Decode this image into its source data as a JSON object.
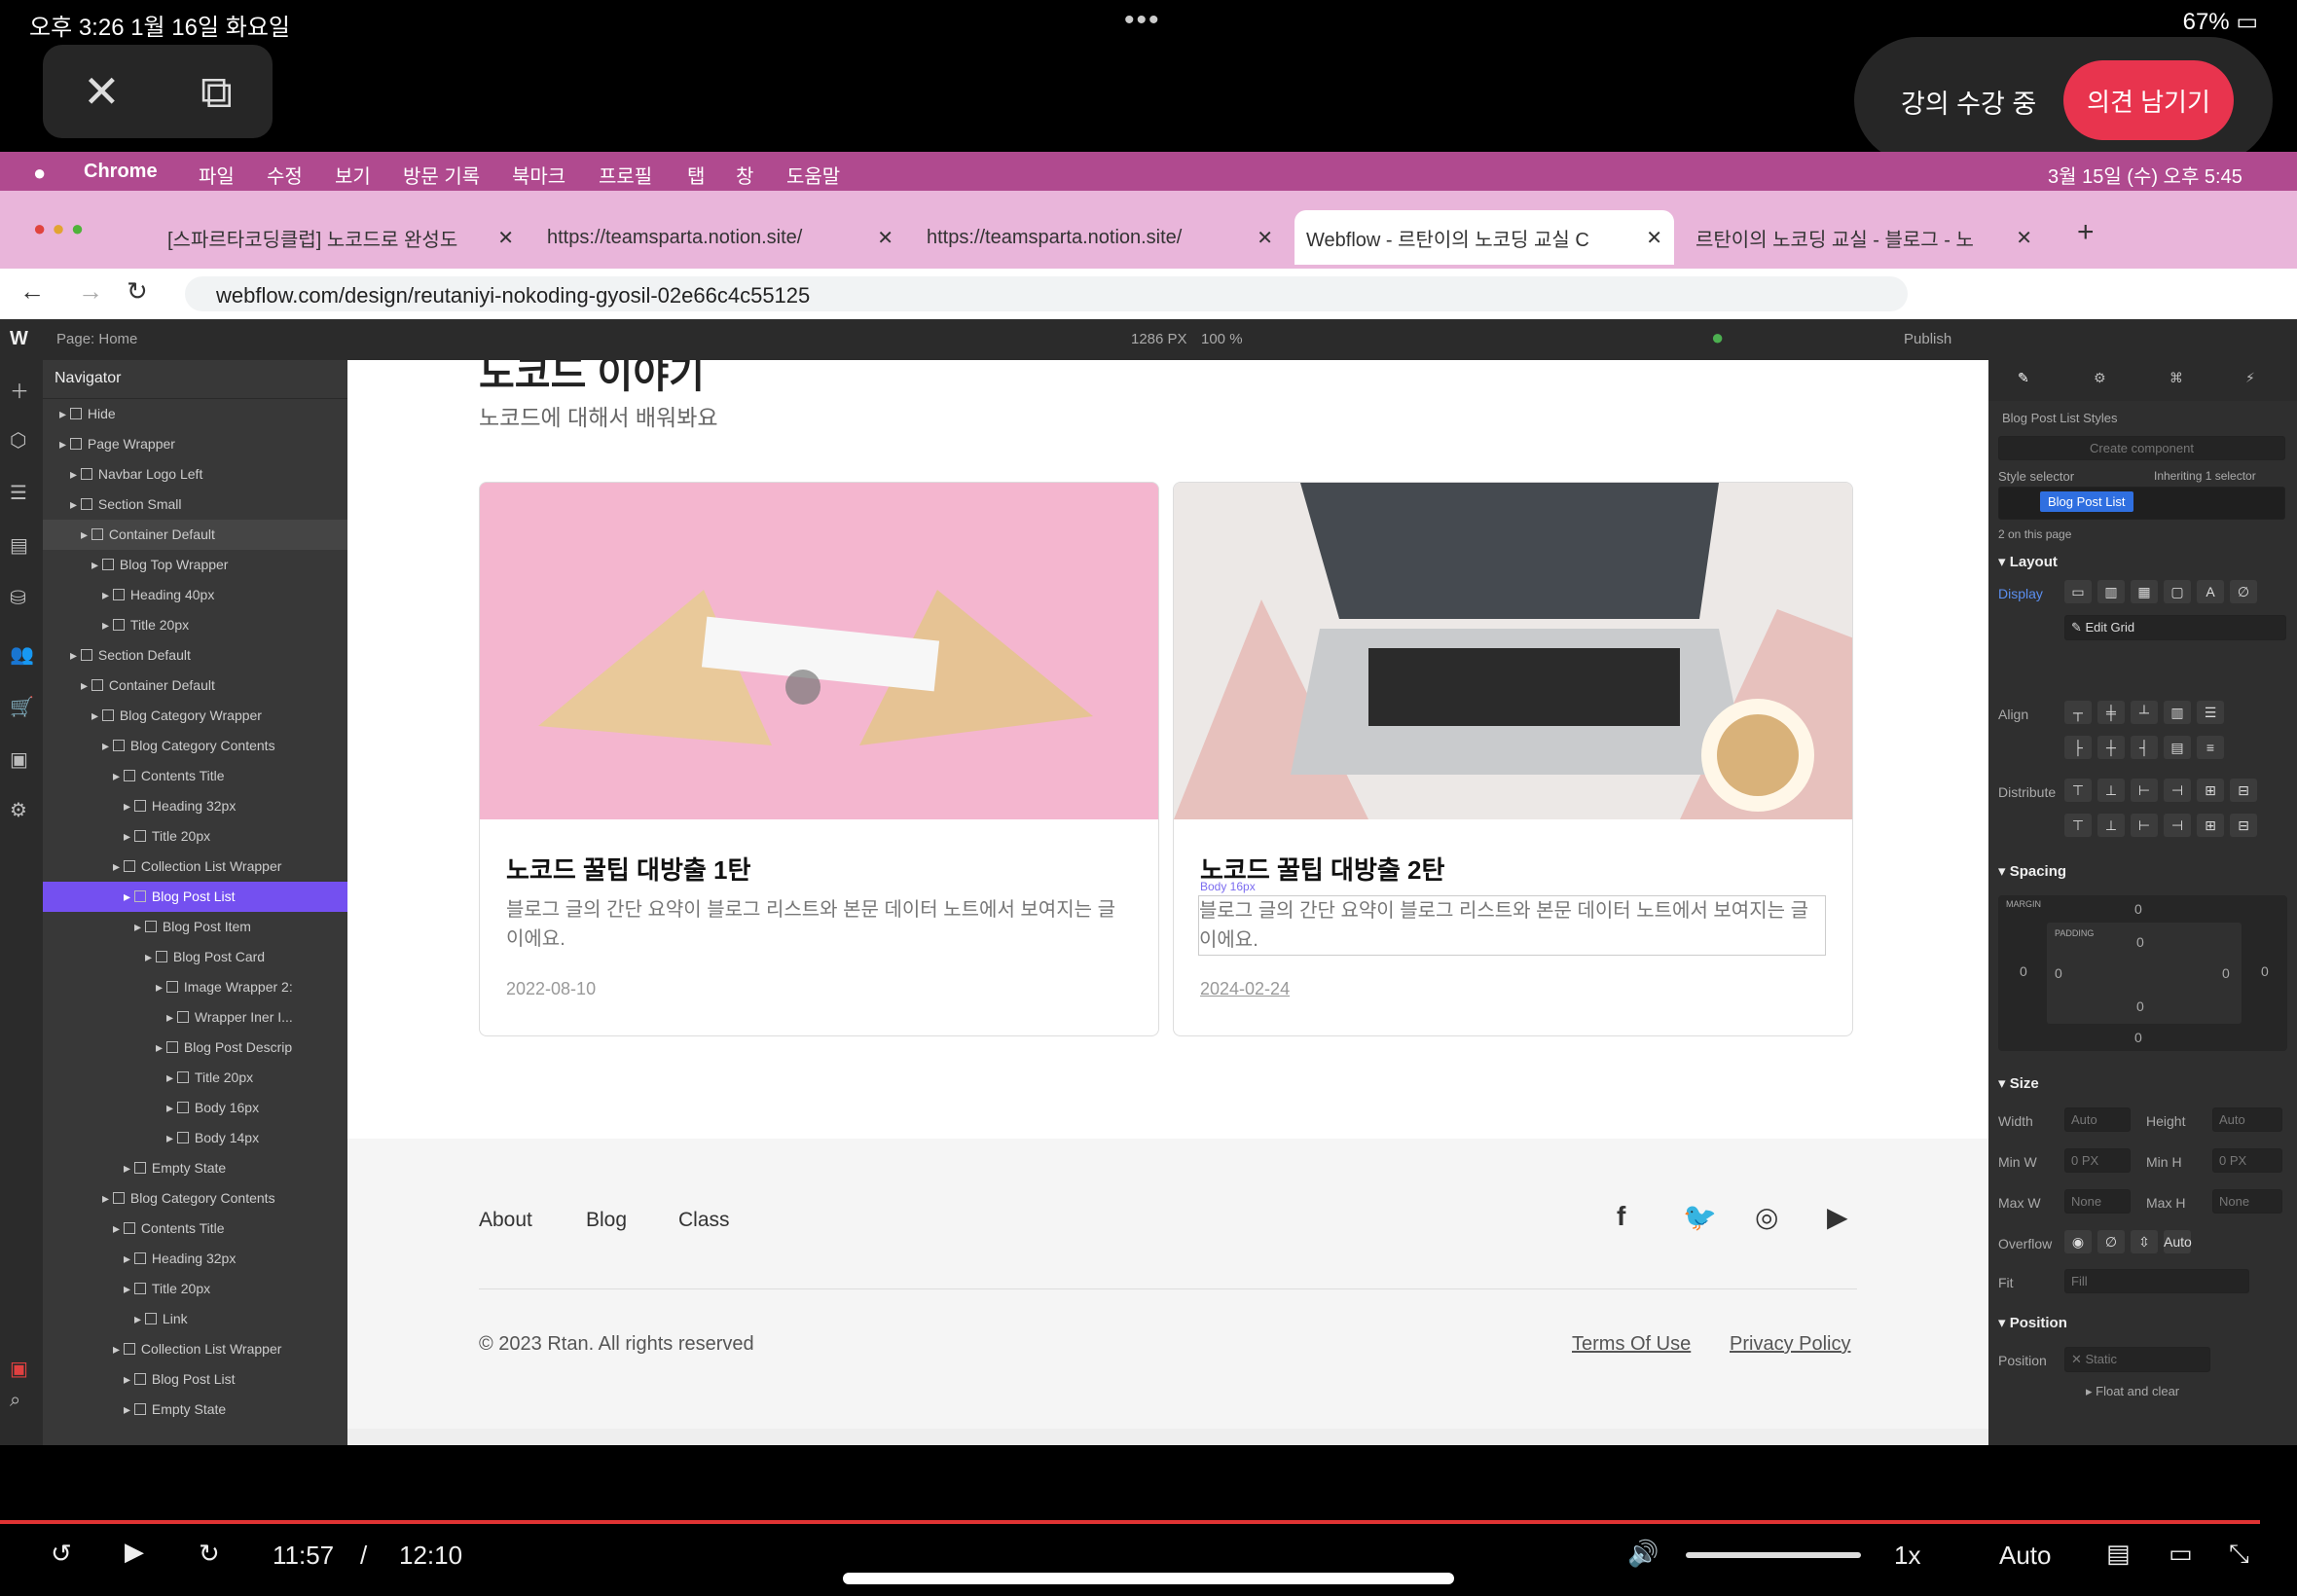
{
  "status": {
    "time": "오후 3:26  1월 16일 화요일",
    "dots": "•••",
    "battery": "67%"
  },
  "overlay": {
    "close": "✕",
    "pip": "⧉",
    "lecture_text": "강의 수강 중",
    "feedback_btn": "의견 남기기"
  },
  "mac_menu": {
    "items": [
      "",
      "Chrome",
      "파일",
      "수정",
      "보기",
      "방문 기록",
      "북마크",
      "프로필",
      "탭",
      "창",
      "도움말"
    ],
    "clock": "3월 15일 (수) 오후 5:45"
  },
  "tabs": [
    {
      "label": "[스파르타코딩클럽] 노코드로 완성도",
      "close": "✕"
    },
    {
      "label": "https://teamsparta.notion.site/",
      "close": "✕"
    },
    {
      "label": "https://teamsparta.notion.site/",
      "close": "✕"
    },
    {
      "label": "Webflow - 르탄이의 노코딩 교실 C",
      "close": "✕"
    },
    {
      "label": "르탄이의 노코딩 교실 - 블로그 - 노",
      "close": "✕"
    }
  ],
  "address": {
    "url": "webflow.com/design/reutaniyi-nokoding-gyosil-02e66c4c55125"
  },
  "webflow_top": {
    "page": "Page: Home",
    "width": "1286 PX",
    "zoom": "100 %",
    "publish": "Publish"
  },
  "navigator": {
    "title": "Navigator",
    "rows": [
      "Hide",
      "Page Wrapper",
      "Navbar Logo Left",
      "Section Small",
      "Container Default",
      "Blog Top Wrapper",
      "Heading 40px",
      "Title 20px",
      "Section Default",
      "Container Default",
      "Blog Category Wrapper",
      "Blog Category Contents",
      "Contents Title",
      "Heading 32px",
      "Title 20px",
      "Collection List Wrapper",
      "Blog Post List",
      "Blog Post Item",
      "Blog Post Card",
      "Image Wrapper 2:",
      "Wrapper Iner I...",
      "Blog Post Descrip",
      "Title 20px",
      "Body 16px",
      "Body 14px",
      "Empty State",
      "Blog Category Contents",
      "Contents Title",
      "Heading 32px",
      "Title 20px",
      "Link",
      "Collection List Wrapper",
      "Blog Post List",
      "Empty State"
    ]
  },
  "canvas": {
    "heading_cut": "노코드 이야기",
    "subtitle": "노코드에 대해서 배워봐요",
    "cards": [
      {
        "title": "노코드 꿀팁 대방출 1탄",
        "desc": "블로그 글의 간단 요약이 블로그 리스트와 본문 데이터 노트에서 보여지는 글이에요.",
        "date": "2022-08-10"
      },
      {
        "title": "노코드 꿀팁 대방출 2탄",
        "desc": "블로그 글의 간단 요약이 블로그 리스트와 본문 데이터 노트에서 보여지는 글이에요.",
        "date": "2024-02-24",
        "tag": "Body 16px"
      }
    ],
    "footer": {
      "links": [
        "About",
        "Blog",
        "Class"
      ],
      "copyright": "© 2023 Rtan. All rights reserved",
      "terms": "Terms Of Use",
      "privacy": "Privacy Policy"
    }
  },
  "style_panel": {
    "header": "Blog Post List Styles",
    "create_component": "Create component",
    "style_selector": "Style selector",
    "inheriting": "Inheriting 1 selector",
    "class_name": "Blog Post List",
    "on_page": "2 on this page",
    "layout": "Layout",
    "display": "Display",
    "edit_grid": "Edit Grid",
    "align": "Align",
    "distribute": "Distribute",
    "spacing": "Spacing",
    "margin": "MARGIN",
    "padding": "PADDING",
    "zero": "0",
    "size": "Size",
    "width": "Width",
    "height": "Height",
    "minw": "Min W",
    "minh": "Min H",
    "maxw": "Max W",
    "maxh": "Max H",
    "auto": "Auto",
    "none": "None",
    "px": "PX",
    "overflow": "Overflow",
    "fit": "Fit",
    "fill": "Fill",
    "position_sec": "Position",
    "position": "Position",
    "static": "Static",
    "float": "Float and clear"
  },
  "video": {
    "current": "11:57",
    "sep": "/",
    "total": "12:10",
    "speed": "1x",
    "quality": "Auto",
    "progress": 0.984
  }
}
